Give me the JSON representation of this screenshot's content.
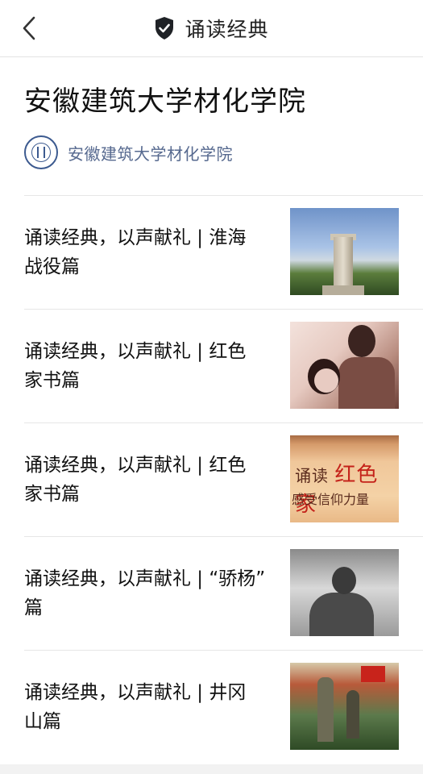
{
  "nav": {
    "title": "诵读经典",
    "back_icon": "chevron-left-icon",
    "title_icon": "shield-check-icon"
  },
  "header": {
    "title": "安徽建筑大学材化学院"
  },
  "account": {
    "name": "安徽建筑大学材化学院"
  },
  "articles": [
    {
      "title_line1": "诵读经典，以声献礼 | 淮海",
      "title_line2": "战役篇",
      "thumb": "monument-photo"
    },
    {
      "title_line1": "诵读经典，以声献礼 | 红色",
      "title_line2": "家书篇",
      "thumb": "couple-photo"
    },
    {
      "title_line1": "诵读经典，以声献礼 | 红色",
      "title_line2": "家书篇",
      "thumb": "calligraphy-photo",
      "thumb_text": {
        "line1_a": "诵读",
        "line1_b": "红色家",
        "line2": "感受信仰力量"
      }
    },
    {
      "title_line1": "诵读经典，以声献礼 | “骄杨”",
      "title_line2": "篇",
      "thumb": "statue-photo"
    },
    {
      "title_line1": "诵读经典，以声献礼 | 井冈",
      "title_line2": "山篇",
      "thumb": "painting-photo"
    }
  ],
  "colors": {
    "account_text": "#56698f",
    "divider": "#e6e6e6"
  }
}
